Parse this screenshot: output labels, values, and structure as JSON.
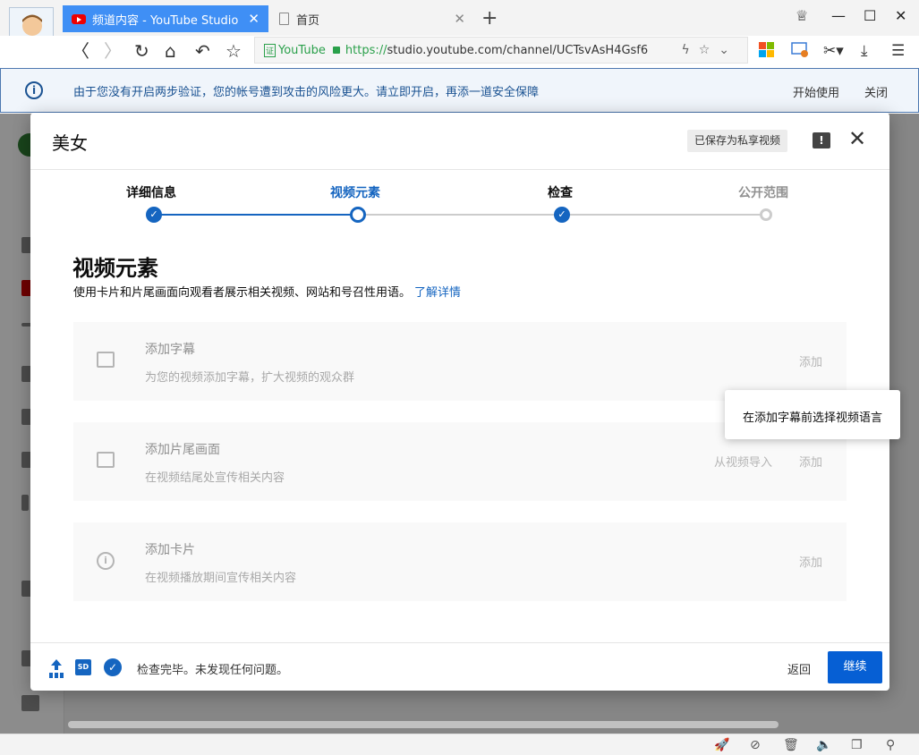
{
  "browser": {
    "tabs": [
      {
        "label": "频道内容 - YouTube Studio",
        "active": true
      },
      {
        "label": "首页",
        "active": false
      }
    ],
    "address": {
      "cert_label": "YouTube",
      "cert_badge": "证",
      "url_proto": "https://",
      "url_rest": "studio.youtube.com/channel/UCTsvAsH4Gsf6"
    }
  },
  "notice": {
    "message": "由于您没有开启两步验证，您的帐号遭到攻击的风险更大。请立即开启，再添一道安全保障",
    "enable_label": "开始使用",
    "close_label": "关闭"
  },
  "dialog": {
    "title": "美女",
    "saved_badge": "已保存为私享视频",
    "steps": [
      {
        "label": "详细信息",
        "state": "done"
      },
      {
        "label": "视频元素",
        "state": "current"
      },
      {
        "label": "检查",
        "state": "done"
      },
      {
        "label": "公开范围",
        "state": "todo"
      }
    ],
    "heading": "视频元素",
    "subtitle": "使用卡片和片尾画面向观看者展示相关视频、网站和号召性用语。",
    "learn_more": "了解详情",
    "cards": [
      {
        "title": "添加字幕",
        "desc": "为您的视频添加字幕，扩大视频的观众群",
        "action": "添加",
        "icon": "subtitles-icon"
      },
      {
        "title": "添加片尾画面",
        "desc": "在视频结尾处宣传相关内容",
        "import_action": "从视频导入",
        "action": "添加",
        "icon": "end-screen-icon"
      },
      {
        "title": "添加卡片",
        "desc": "在视频播放期间宣传相关内容",
        "action": "添加",
        "icon": "info-icon"
      }
    ],
    "tooltip": "在添加字幕前选择视频语言",
    "footer": {
      "sd_badge": "SD",
      "status": "检查完毕。未发现任何问题。",
      "back_label": "返回",
      "next_label": "继续"
    }
  },
  "colors": {
    "accent": "#065fd4",
    "step_blue": "#1565c0",
    "tab_active": "#3f8ff5"
  }
}
